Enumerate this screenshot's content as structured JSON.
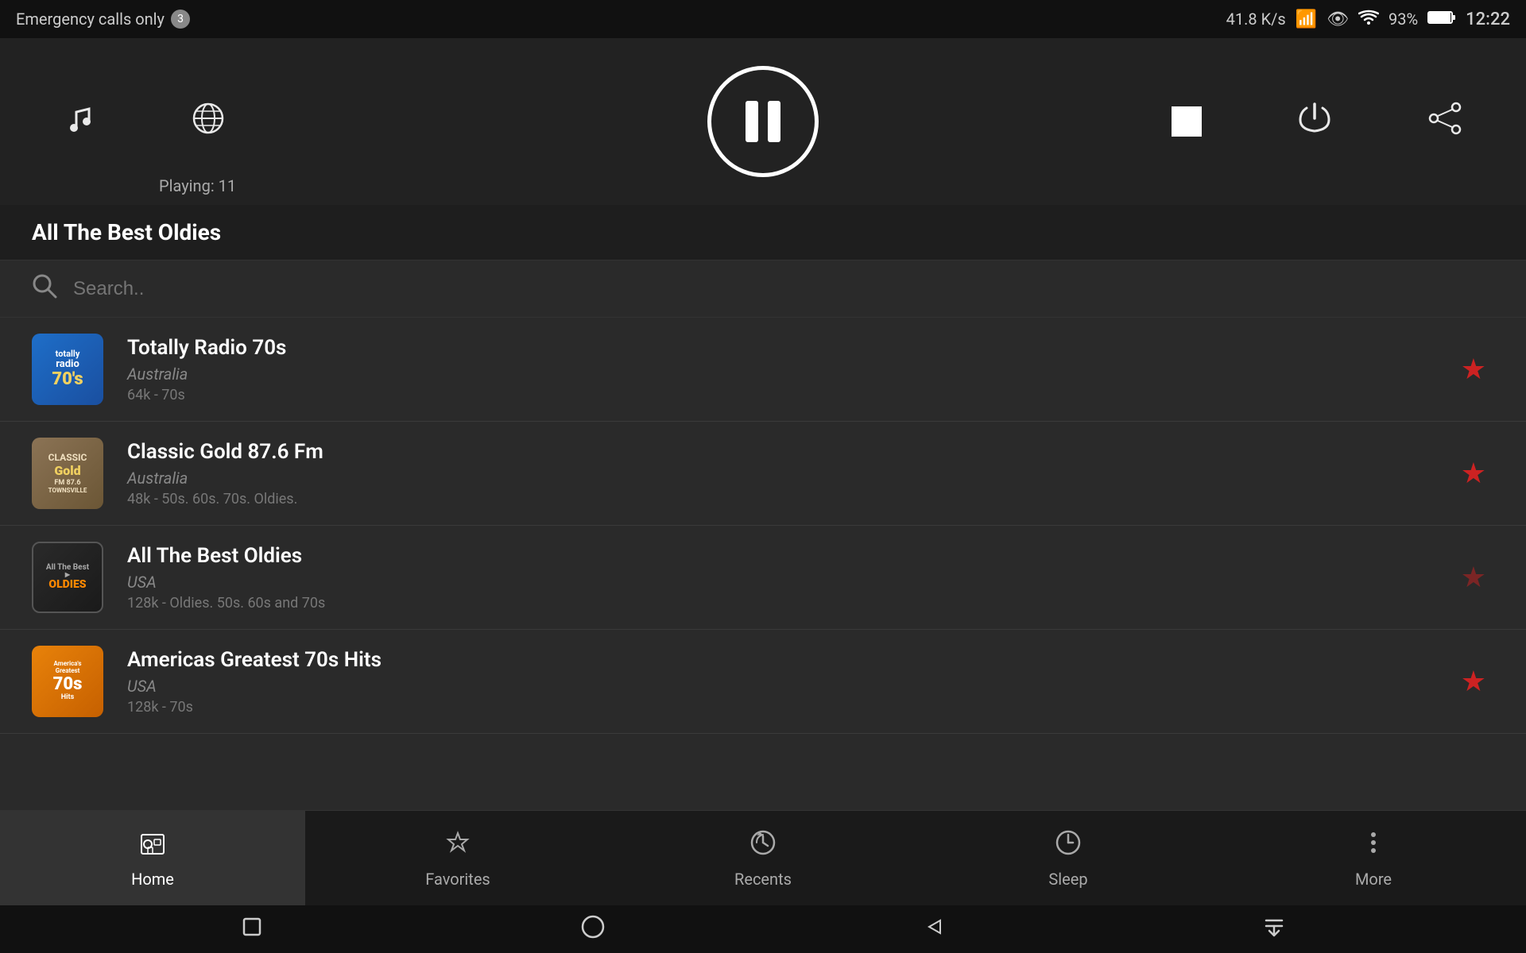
{
  "status": {
    "emergency_text": "Emergency calls only",
    "badge": "3",
    "network_speed": "41.8 K/s",
    "battery": "93%",
    "time": "12:22"
  },
  "player": {
    "playing_label": "Playing: 11",
    "pause_title": "Pause",
    "stop_title": "Stop",
    "power_title": "Power",
    "share_title": "Share",
    "music_title": "Music",
    "globe_title": "Globe"
  },
  "now_playing": {
    "title": "All The Best Oldies"
  },
  "search": {
    "placeholder": "Search.."
  },
  "stations": [
    {
      "id": 1,
      "name": "Totally Radio 70s",
      "country": "Australia",
      "meta": "64k - 70s",
      "favorited": true,
      "logo_type": "70s"
    },
    {
      "id": 2,
      "name": "Classic Gold 87.6 Fm",
      "country": "Australia",
      "meta": "48k - 50s. 60s. 70s. Oldies.",
      "favorited": true,
      "logo_type": "classic"
    },
    {
      "id": 3,
      "name": "All The Best Oldies",
      "country": "USA",
      "meta": "128k - Oldies. 50s. 60s and 70s",
      "favorited": false,
      "logo_type": "oldies"
    },
    {
      "id": 4,
      "name": "Americas Greatest 70s Hits",
      "country": "USA",
      "meta": "128k - 70s",
      "favorited": true,
      "logo_type": "americas"
    }
  ],
  "bottom_nav": {
    "items": [
      {
        "id": "home",
        "label": "Home",
        "icon": "home",
        "active": true
      },
      {
        "id": "favorites",
        "label": "Favorites",
        "icon": "star",
        "active": false
      },
      {
        "id": "recents",
        "label": "Recents",
        "icon": "history",
        "active": false
      },
      {
        "id": "sleep",
        "label": "Sleep",
        "icon": "sleep",
        "active": false
      },
      {
        "id": "more",
        "label": "More",
        "icon": "more",
        "active": false
      }
    ]
  },
  "android_nav": {
    "square_title": "Recent apps",
    "circle_title": "Home",
    "back_title": "Back",
    "down_title": "Down"
  }
}
